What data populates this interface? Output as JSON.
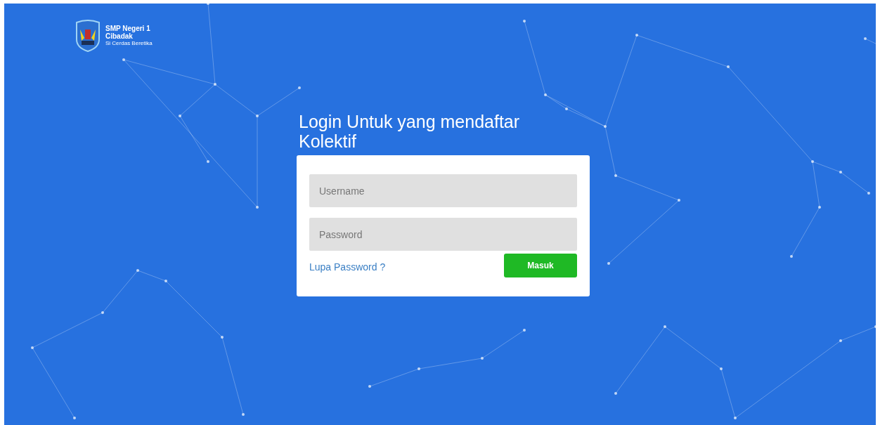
{
  "brand": {
    "name_line_1": "SMP Negeri 1",
    "name_line_2": "Cibadak",
    "tagline": "Si Cerdas Beretika"
  },
  "login": {
    "title": "Login Untuk yang mendaftar Kolektif",
    "fields": [
      {
        "placeholder": "Username"
      },
      {
        "placeholder": "Password"
      }
    ],
    "forgot_link": "Lupa Password ?",
    "submit_button": "Masuk"
  }
}
